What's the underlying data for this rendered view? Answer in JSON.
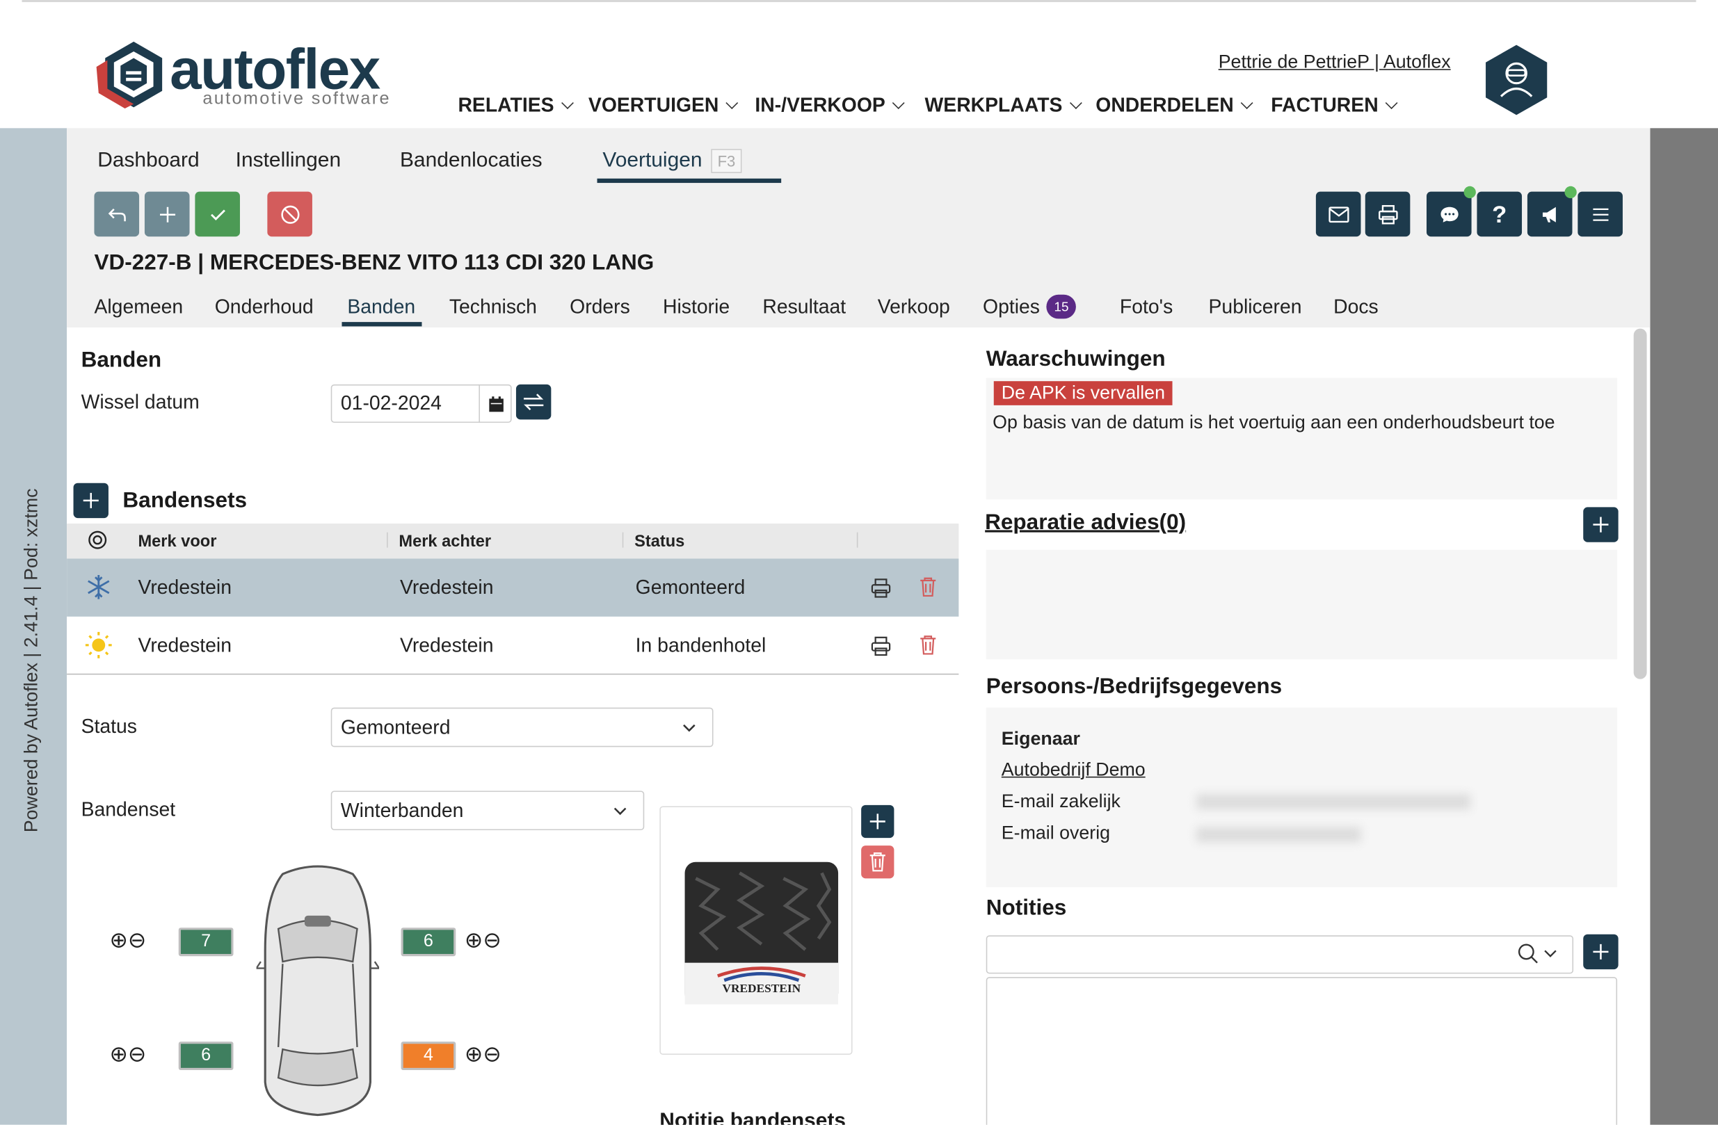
{
  "app": {
    "logo_main": "autoflex",
    "logo_sub": "automotive software",
    "powered_by": "Powered by Autoflex | 2.41.4 | Pod: xztmc",
    "user_link": "Pettrie de PettrieP | Autoflex",
    "brand_color": "#1d3a4c"
  },
  "nav": [
    {
      "label": "RELATIES"
    },
    {
      "label": "VOERTUIGEN"
    },
    {
      "label": "IN-/VERKOOP"
    },
    {
      "label": "WERKPLAATS"
    },
    {
      "label": "ONDERDELEN"
    },
    {
      "label": "FACTUREN"
    }
  ],
  "tabs_main": [
    {
      "label": "Dashboard"
    },
    {
      "label": "Instellingen"
    },
    {
      "label": "Bandenlocaties"
    },
    {
      "label": "Voertuigen",
      "shortcut": "F3",
      "active": true
    }
  ],
  "vehicle": {
    "title": "VD-227-B | MERCEDES-BENZ VITO 113 CDI 320 LANG"
  },
  "tabs_vehicle": [
    {
      "label": "Algemeen"
    },
    {
      "label": "Onderhoud"
    },
    {
      "label": "Banden",
      "active": true
    },
    {
      "label": "Technisch"
    },
    {
      "label": "Orders"
    },
    {
      "label": "Historie"
    },
    {
      "label": "Resultaat"
    },
    {
      "label": "Verkoop"
    },
    {
      "label": "Opties",
      "badge": "15"
    },
    {
      "label": "Foto's"
    },
    {
      "label": "Publiceren"
    },
    {
      "label": "Docs"
    }
  ],
  "banden": {
    "title": "Banden",
    "wissel_label": "Wissel datum",
    "wissel_value": "01-02-2024"
  },
  "bandensets": {
    "title": "Bandensets",
    "columns": [
      "Merk voor",
      "Merk achter",
      "Status"
    ],
    "rows": [
      {
        "icon": "snowflake-icon",
        "front": "Vredestein",
        "rear": "Vredestein",
        "status": "Gemonteerd",
        "selected": true
      },
      {
        "icon": "sun-icon",
        "front": "Vredestein",
        "rear": "Vredestein",
        "status": "In bandenhotel",
        "selected": false
      }
    ]
  },
  "form": {
    "status_label": "Status",
    "status_value": "Gemonteerd",
    "bandenset_label": "Bandenset",
    "bandenset_value": "Winterbanden"
  },
  "tyres": {
    "front_left": {
      "value": "7",
      "color": "#3f7f5f"
    },
    "front_right": {
      "value": "6",
      "color": "#3f7f5f"
    },
    "rear_left": {
      "value": "6",
      "color": "#3f7f5f"
    },
    "rear_right": {
      "value": "4",
      "color": "#f07f2a"
    }
  },
  "tyre_image_brand": "VREDESTEIN",
  "notitie_bandensets": "Notitie bandensets",
  "warnings": {
    "title": "Waarschuwingen",
    "alert": "De APK is vervallen",
    "text": "Op basis van de datum is het voertuig aan een onderhoudsbeurt toe",
    "alert_color": "#c9413d"
  },
  "reparatie": {
    "title": "Reparatie advies(0)"
  },
  "persoon": {
    "title": "Persoons-/Bedrijfsgegevens",
    "owner_label": "Eigenaar",
    "owner_link": "Autobedrijf Demo",
    "email_zakelijk_label": "E-mail zakelijk",
    "email_overig_label": "E-mail overig"
  },
  "notities": {
    "title": "Notities"
  }
}
